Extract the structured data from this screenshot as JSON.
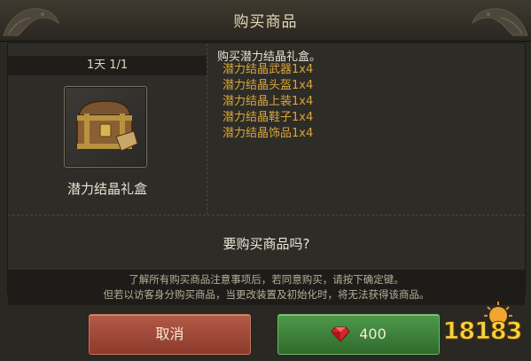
{
  "dialog": {
    "title": "购买商品"
  },
  "item": {
    "period": "1天 1/1",
    "name": "潜力结晶礼盒",
    "icon": "treasure-chest-icon"
  },
  "description": {
    "title": "购买潜力结晶礼盒。",
    "contents": [
      "潜力结晶武器1x4",
      "潜力结晶头盔1x4",
      "潜力结晶上装1x4",
      "潜力结晶鞋子1x4",
      "潜力结晶饰品1x4"
    ],
    "content_color": "#d9a63c"
  },
  "confirm": {
    "question": "要购买商品吗?",
    "notice_lines": [
      "了解所有购买商品注意事项后，若同意购买，请按下确定键。",
      "但若以访客身分购买商品，当更改装置及初始化时，将无法获得该商品。"
    ]
  },
  "buttons": {
    "cancel_label": "取消",
    "buy_price": "400",
    "buy_icon": "ruby-gem-icon",
    "cancel_color": "#a5483a",
    "buy_color": "#3f8a3c"
  },
  "watermark": {
    "text": "18183"
  }
}
